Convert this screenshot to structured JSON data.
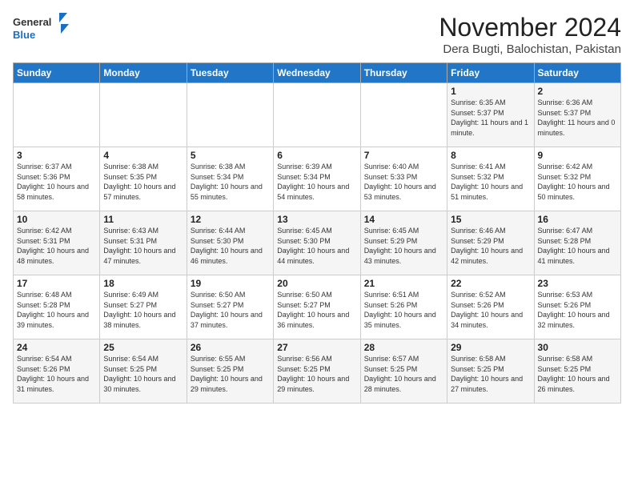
{
  "logo": {
    "general": "General",
    "blue": "Blue"
  },
  "header": {
    "month_year": "November 2024",
    "location": "Dera Bugti, Balochistan, Pakistan"
  },
  "days_of_week": [
    "Sunday",
    "Monday",
    "Tuesday",
    "Wednesday",
    "Thursday",
    "Friday",
    "Saturday"
  ],
  "weeks": [
    [
      {
        "day": "",
        "info": ""
      },
      {
        "day": "",
        "info": ""
      },
      {
        "day": "",
        "info": ""
      },
      {
        "day": "",
        "info": ""
      },
      {
        "day": "",
        "info": ""
      },
      {
        "day": "1",
        "info": "Sunrise: 6:35 AM\nSunset: 5:37 PM\nDaylight: 11 hours and 1 minute."
      },
      {
        "day": "2",
        "info": "Sunrise: 6:36 AM\nSunset: 5:37 PM\nDaylight: 11 hours and 0 minutes."
      }
    ],
    [
      {
        "day": "3",
        "info": "Sunrise: 6:37 AM\nSunset: 5:36 PM\nDaylight: 10 hours and 58 minutes."
      },
      {
        "day": "4",
        "info": "Sunrise: 6:38 AM\nSunset: 5:35 PM\nDaylight: 10 hours and 57 minutes."
      },
      {
        "day": "5",
        "info": "Sunrise: 6:38 AM\nSunset: 5:34 PM\nDaylight: 10 hours and 55 minutes."
      },
      {
        "day": "6",
        "info": "Sunrise: 6:39 AM\nSunset: 5:34 PM\nDaylight: 10 hours and 54 minutes."
      },
      {
        "day": "7",
        "info": "Sunrise: 6:40 AM\nSunset: 5:33 PM\nDaylight: 10 hours and 53 minutes."
      },
      {
        "day": "8",
        "info": "Sunrise: 6:41 AM\nSunset: 5:32 PM\nDaylight: 10 hours and 51 minutes."
      },
      {
        "day": "9",
        "info": "Sunrise: 6:42 AM\nSunset: 5:32 PM\nDaylight: 10 hours and 50 minutes."
      }
    ],
    [
      {
        "day": "10",
        "info": "Sunrise: 6:42 AM\nSunset: 5:31 PM\nDaylight: 10 hours and 48 minutes."
      },
      {
        "day": "11",
        "info": "Sunrise: 6:43 AM\nSunset: 5:31 PM\nDaylight: 10 hours and 47 minutes."
      },
      {
        "day": "12",
        "info": "Sunrise: 6:44 AM\nSunset: 5:30 PM\nDaylight: 10 hours and 46 minutes."
      },
      {
        "day": "13",
        "info": "Sunrise: 6:45 AM\nSunset: 5:30 PM\nDaylight: 10 hours and 44 minutes."
      },
      {
        "day": "14",
        "info": "Sunrise: 6:45 AM\nSunset: 5:29 PM\nDaylight: 10 hours and 43 minutes."
      },
      {
        "day": "15",
        "info": "Sunrise: 6:46 AM\nSunset: 5:29 PM\nDaylight: 10 hours and 42 minutes."
      },
      {
        "day": "16",
        "info": "Sunrise: 6:47 AM\nSunset: 5:28 PM\nDaylight: 10 hours and 41 minutes."
      }
    ],
    [
      {
        "day": "17",
        "info": "Sunrise: 6:48 AM\nSunset: 5:28 PM\nDaylight: 10 hours and 39 minutes."
      },
      {
        "day": "18",
        "info": "Sunrise: 6:49 AM\nSunset: 5:27 PM\nDaylight: 10 hours and 38 minutes."
      },
      {
        "day": "19",
        "info": "Sunrise: 6:50 AM\nSunset: 5:27 PM\nDaylight: 10 hours and 37 minutes."
      },
      {
        "day": "20",
        "info": "Sunrise: 6:50 AM\nSunset: 5:27 PM\nDaylight: 10 hours and 36 minutes."
      },
      {
        "day": "21",
        "info": "Sunrise: 6:51 AM\nSunset: 5:26 PM\nDaylight: 10 hours and 35 minutes."
      },
      {
        "day": "22",
        "info": "Sunrise: 6:52 AM\nSunset: 5:26 PM\nDaylight: 10 hours and 34 minutes."
      },
      {
        "day": "23",
        "info": "Sunrise: 6:53 AM\nSunset: 5:26 PM\nDaylight: 10 hours and 32 minutes."
      }
    ],
    [
      {
        "day": "24",
        "info": "Sunrise: 6:54 AM\nSunset: 5:26 PM\nDaylight: 10 hours and 31 minutes."
      },
      {
        "day": "25",
        "info": "Sunrise: 6:54 AM\nSunset: 5:25 PM\nDaylight: 10 hours and 30 minutes."
      },
      {
        "day": "26",
        "info": "Sunrise: 6:55 AM\nSunset: 5:25 PM\nDaylight: 10 hours and 29 minutes."
      },
      {
        "day": "27",
        "info": "Sunrise: 6:56 AM\nSunset: 5:25 PM\nDaylight: 10 hours and 29 minutes."
      },
      {
        "day": "28",
        "info": "Sunrise: 6:57 AM\nSunset: 5:25 PM\nDaylight: 10 hours and 28 minutes."
      },
      {
        "day": "29",
        "info": "Sunrise: 6:58 AM\nSunset: 5:25 PM\nDaylight: 10 hours and 27 minutes."
      },
      {
        "day": "30",
        "info": "Sunrise: 6:58 AM\nSunset: 5:25 PM\nDaylight: 10 hours and 26 minutes."
      }
    ]
  ]
}
